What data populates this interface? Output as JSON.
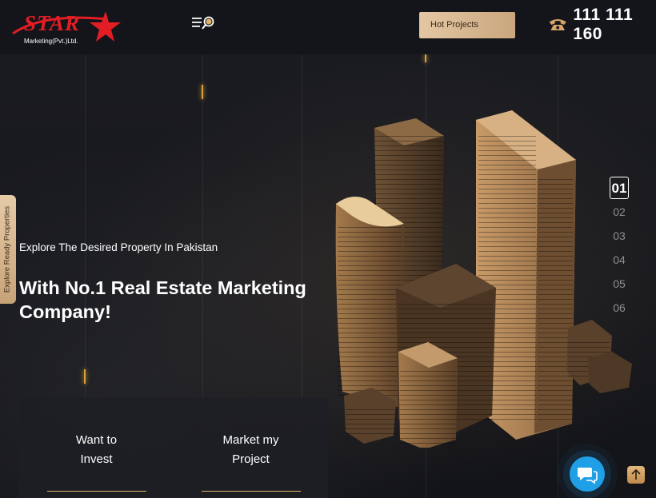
{
  "header": {
    "logo_text": "STAR",
    "logo_subtext": "Marketing(Pvt.)Ltd.",
    "hot_projects_label": "Hot Projects",
    "phone_number": "111 111 160"
  },
  "side_tab": {
    "label": "Explore Ready Properties"
  },
  "hero": {
    "subtitle": "Explore The Desired Property In Pakistan",
    "title": "With No.1 Real Estate Marketing Company!"
  },
  "slides": [
    "01",
    "02",
    "03",
    "04",
    "05",
    "06"
  ],
  "active_slide": "01",
  "cards": [
    {
      "label": "Want to\nInvest"
    },
    {
      "label": "Market my\nProject"
    }
  ],
  "icons": {
    "menu": "menu-search-icon",
    "phone": "phone-icon",
    "chat": "chat-icon",
    "scroll_top": "arrow-up-icon"
  },
  "colors": {
    "brand_red": "#e31d24",
    "accent_gold": "#d8a23a",
    "chat_blue": "#1fa0e6"
  }
}
